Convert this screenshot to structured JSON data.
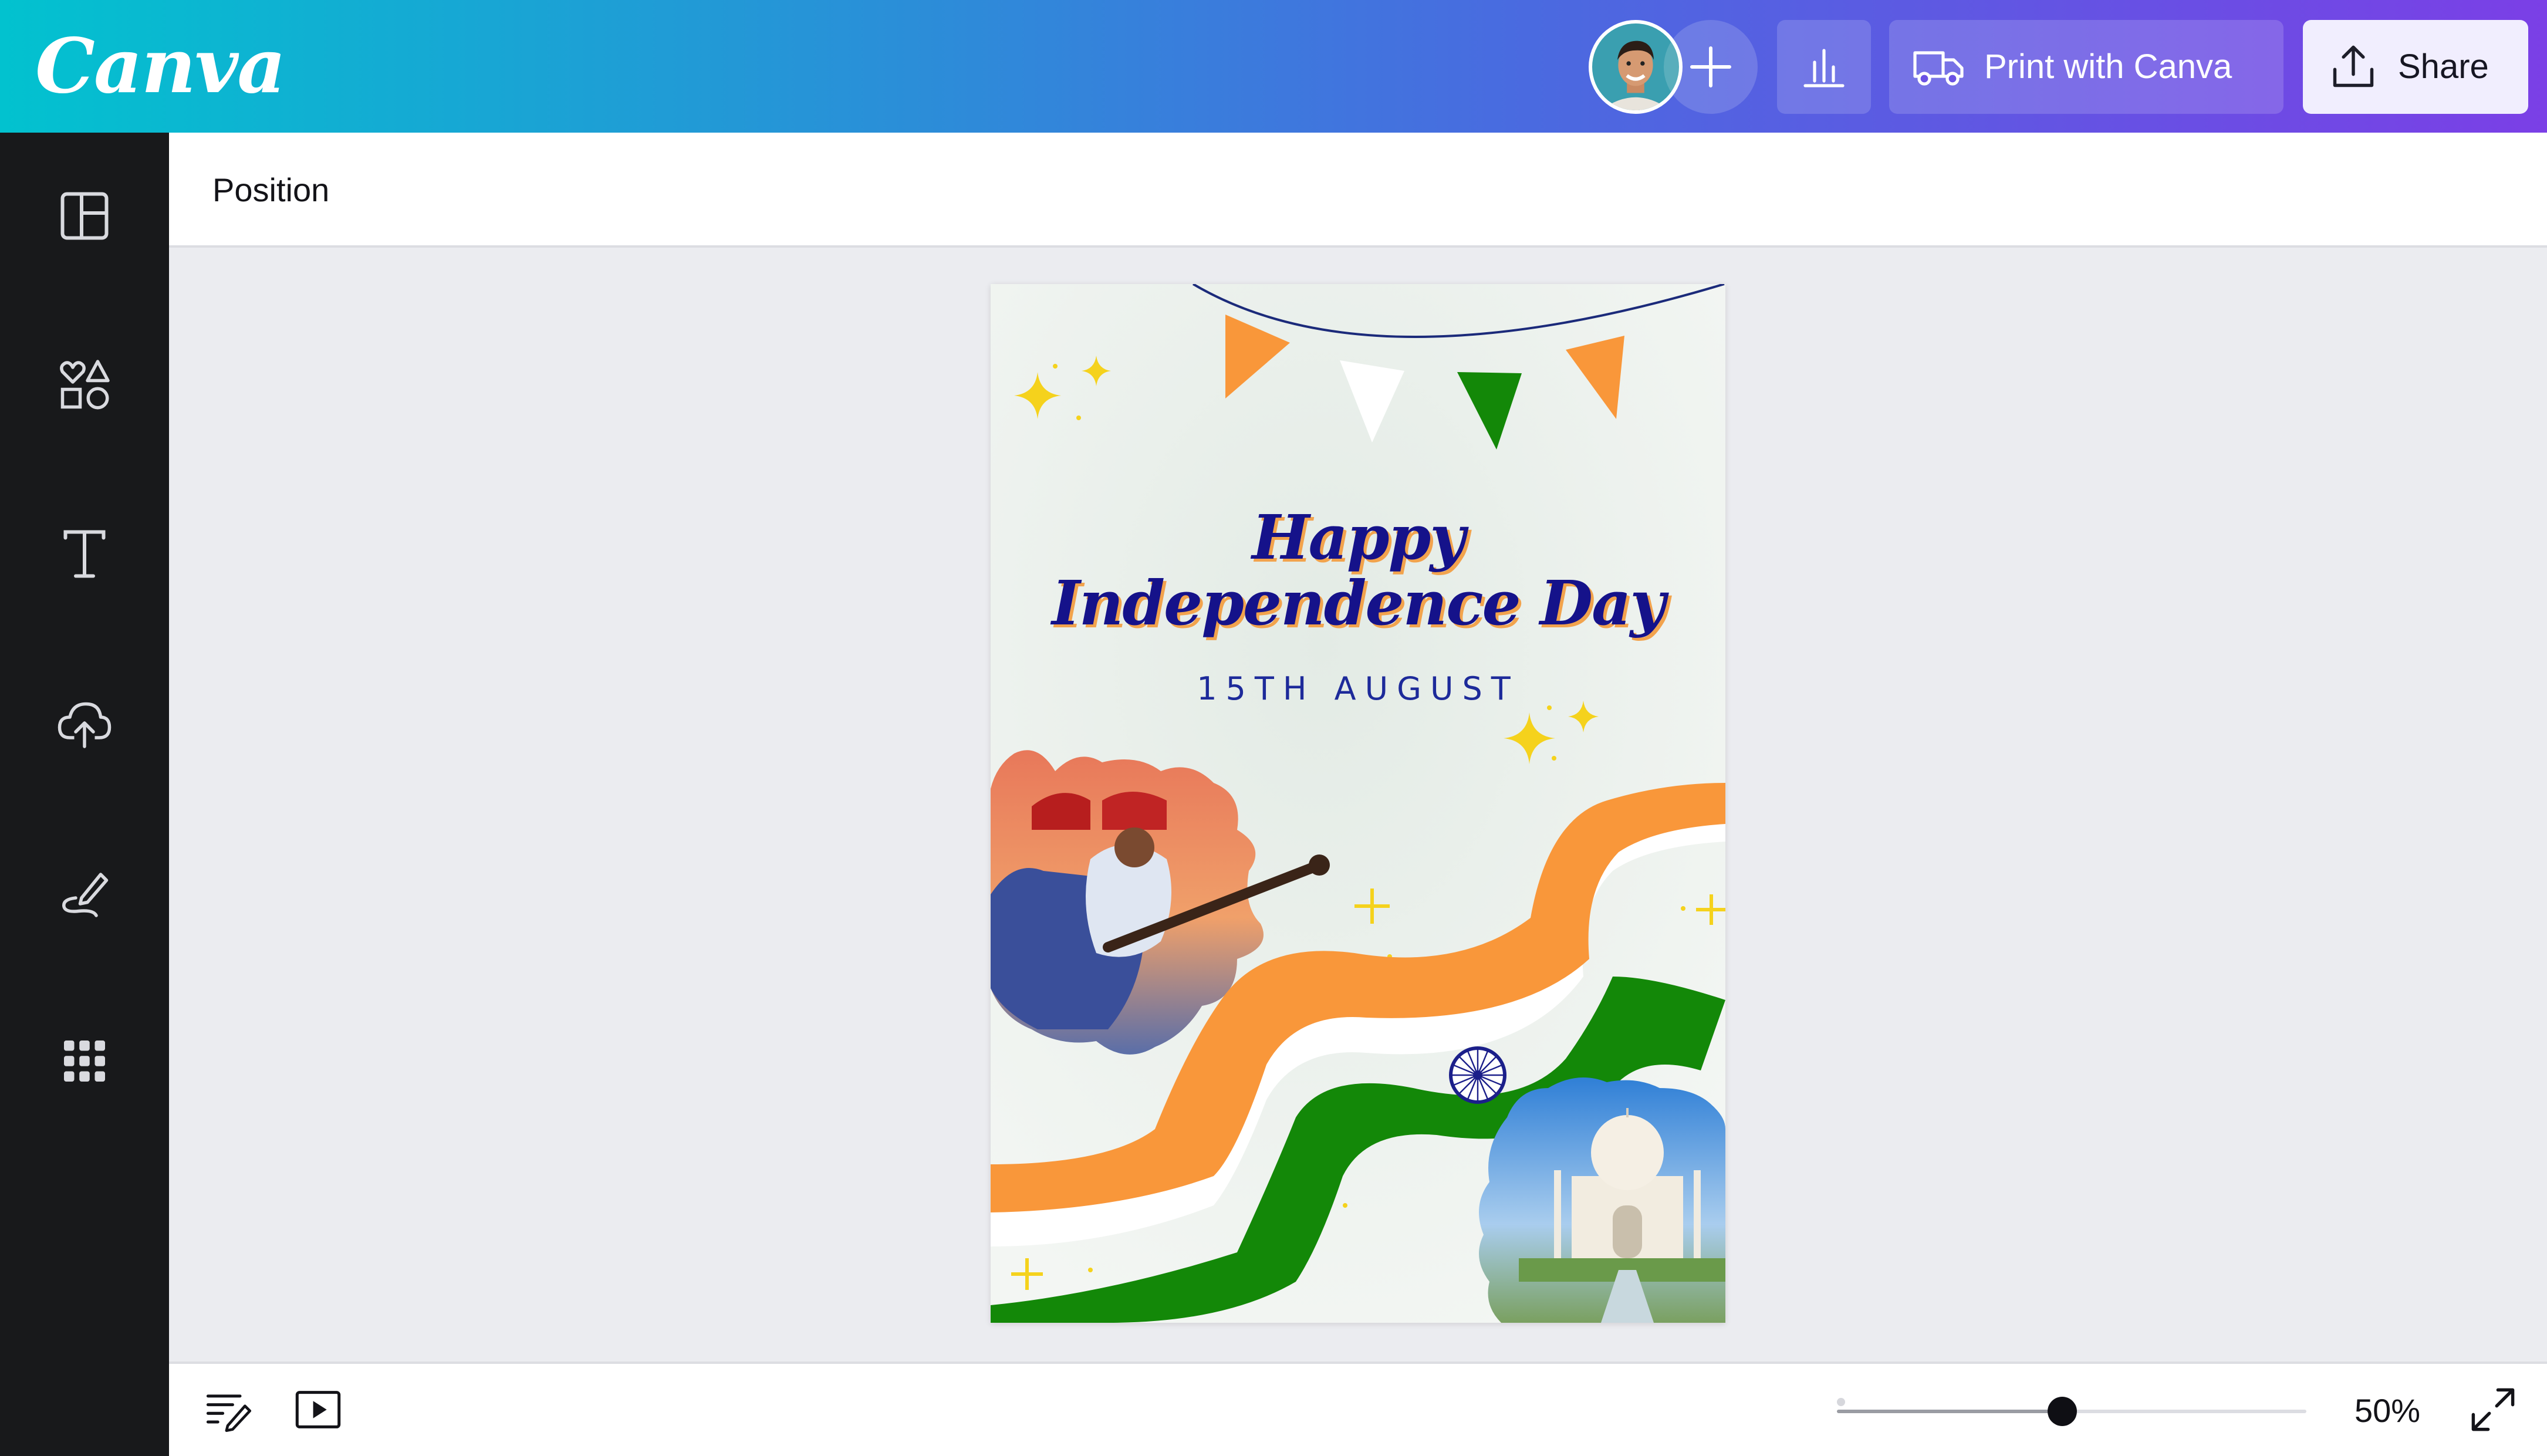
{
  "app": {
    "logo_text": "Canva",
    "brand_gradient": [
      "#02c2cf",
      "#7b3fe6"
    ]
  },
  "header": {
    "avatar_icon": "user-avatar",
    "add_collaborator_icon": "plus-icon",
    "insights_icon": "bar-chart-icon",
    "print_label": "Print with Canva",
    "print_icon": "truck-icon",
    "share_label": "Share",
    "share_icon": "upload-icon"
  },
  "sidebar": {
    "items": [
      {
        "id": "design",
        "icon": "layout-icon"
      },
      {
        "id": "elements",
        "icon": "shapes-icon"
      },
      {
        "id": "text",
        "icon": "text-icon"
      },
      {
        "id": "uploads",
        "icon": "cloud-upload-icon"
      },
      {
        "id": "draw",
        "icon": "pen-icon"
      },
      {
        "id": "apps",
        "icon": "grid-icon"
      }
    ]
  },
  "toolbar": {
    "position_label": "Position"
  },
  "poster": {
    "title_line1": "Happy",
    "title_line2": "Independence Day",
    "subtitle": "15TH AUGUST",
    "colors": {
      "saffron": "#f9973a",
      "green": "#138808",
      "navy": "#15128a",
      "sparkle": "#f5d21c"
    }
  },
  "bottombar": {
    "notes_icon": "notes-icon",
    "present_icon": "play-icon",
    "zoom_percent": 50,
    "zoom_fraction": 0.48,
    "zoom_label": "50%",
    "fullscreen_icon": "expand-icon"
  }
}
